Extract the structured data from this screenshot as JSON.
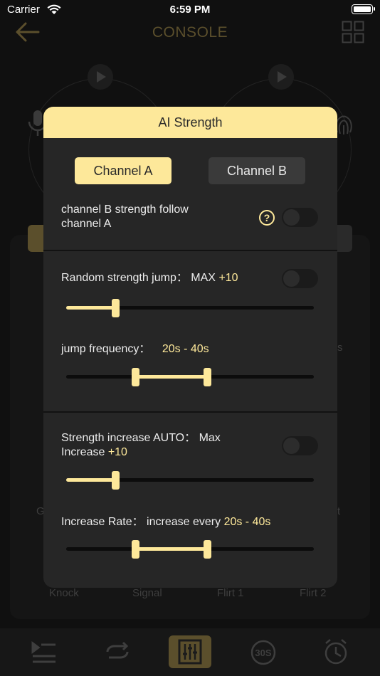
{
  "status": {
    "carrier": "Carrier",
    "time": "6:59 PM"
  },
  "nav": {
    "title": "CONSOLE"
  },
  "background": {
    "side_label_left": "G",
    "side_label_right_1": "s",
    "side_label_right_2": "t",
    "modes": [
      "Knock",
      "Signal",
      "Flirt 1",
      "Flirt 2"
    ],
    "tabs": [
      "list-icon",
      "repeat-icon",
      "equalizer-icon",
      "timer-30s-icon",
      "alarm-icon"
    ]
  },
  "modal": {
    "title": "AI Strength",
    "channel_a": "Channel A",
    "channel_b": "Channel B",
    "follow_line1": "channel B strength follow",
    "follow_line2": "channel A",
    "help_glyph": "?",
    "random_jump_label": "Random strength jump： MAX ",
    "random_jump_value": "+10",
    "random_jump_slider": {
      "level": 0.2
    },
    "jump_freq_label": "jump frequency： ",
    "jump_freq_value": "20s - 40s",
    "jump_freq_range": {
      "low": 0.28,
      "high": 0.57
    },
    "auto_line1": "Strength increase AUTO： Max",
    "auto_line2_prefix": "Increase ",
    "auto_value": "+10",
    "auto_slider": {
      "level": 0.2
    },
    "rate_label": "Increase Rate： increase every ",
    "rate_value": "20s - 40s",
    "rate_range": {
      "low": 0.28,
      "high": 0.57
    }
  },
  "colors": {
    "accent": "#fde89a",
    "panel": "#262626",
    "background": "#101010"
  }
}
